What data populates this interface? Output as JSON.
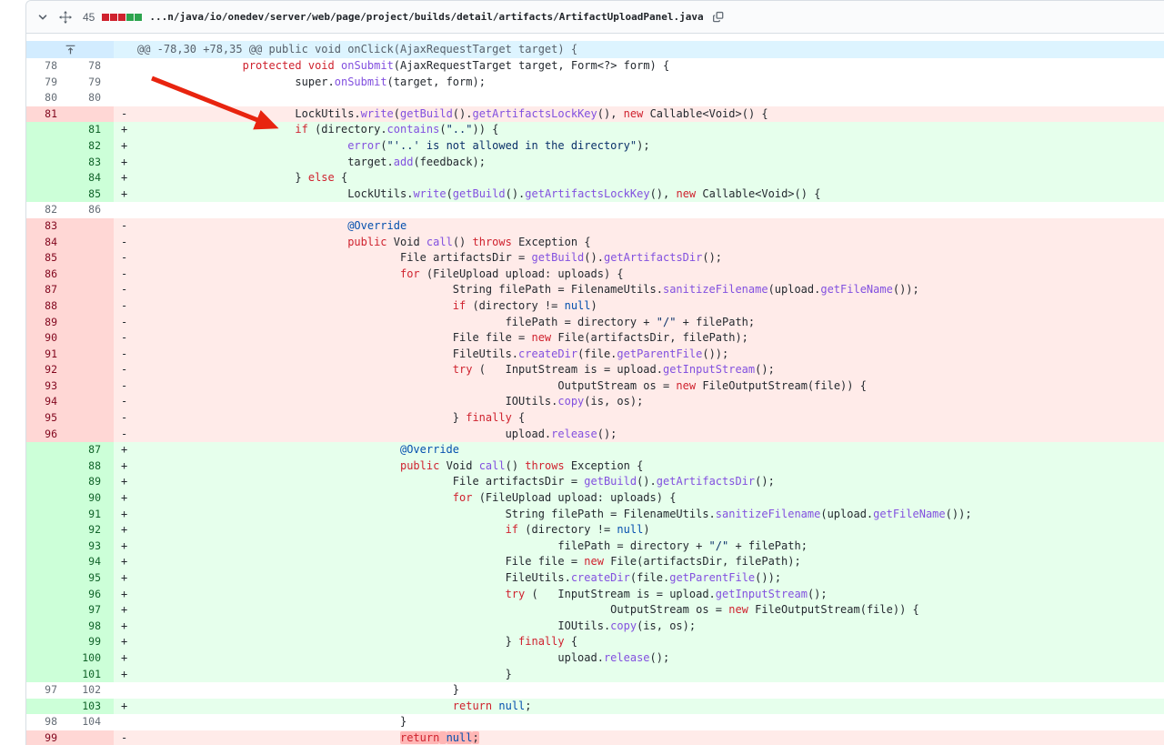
{
  "file_header": {
    "changed_lines": "45",
    "diffstat_colors": [
      "#cf222e",
      "#cf222e",
      "#cf222e",
      "#2da44e",
      "#2da44e"
    ],
    "path": "...n/java/io/onedev/server/web/page/project/builds/detail/artifacts/ArtifactUploadPanel.java",
    "icons": {
      "collapse": "chevron-down-icon",
      "drag": "move-handle-icon",
      "copy": "copy-path-icon",
      "expand": "expand-up-icon"
    }
  },
  "hunk": {
    "header_text": "@@ -78,30 +78,35 @@ public void onClick(AjaxRequestTarget target) {"
  },
  "colors": {
    "addition_line_bg": "#e6ffec",
    "addition_gutter_bg": "#ccffd8",
    "deletion_line_bg": "#ffebe9",
    "deletion_gutter_bg": "#ffd7d5",
    "deletion_word_highlight": "rgba(255,129,130,0.5)",
    "hunk_header_bg": "#ddf4ff",
    "keyword": "#cf222e",
    "method": "#8250df",
    "constant": "#0550ae",
    "string": "#0a3069",
    "annotation_arrow": "#e8240f"
  },
  "diff": {
    "rows": [
      {
        "old": "78",
        "new": "78",
        "type": "ctx",
        "marker": "",
        "indent": 16,
        "segs": [
          [
            "protected",
            "sk"
          ],
          [
            " ",
            "sp"
          ],
          [
            "void",
            "sk"
          ],
          [
            " ",
            "sp"
          ],
          [
            "onSubmit",
            "sf"
          ],
          [
            "(AjaxRequestTarget target, Form<?> form) {",
            "sp"
          ]
        ]
      },
      {
        "old": "79",
        "new": "79",
        "type": "ctx",
        "marker": "",
        "indent": 24,
        "segs": [
          [
            "super.",
            "sp"
          ],
          [
            "onSubmit",
            "sf"
          ],
          [
            "(target, form);",
            "sp"
          ]
        ]
      },
      {
        "old": "80",
        "new": "80",
        "type": "ctx",
        "marker": "",
        "indent": 0,
        "segs": []
      },
      {
        "old": "81",
        "new": "",
        "type": "del",
        "marker": "-",
        "indent": 24,
        "segs": [
          [
            "LockUtils.",
            "sp"
          ],
          [
            "write",
            "sf"
          ],
          [
            "(",
            "sp"
          ],
          [
            "getBuild",
            "sf"
          ],
          [
            "().",
            "sp"
          ],
          [
            "getArtifactsLockKey",
            "sf"
          ],
          [
            "(), ",
            "sp"
          ],
          [
            "new",
            "sk"
          ],
          [
            " Callable<Void>() {",
            "sp"
          ]
        ]
      },
      {
        "old": "",
        "new": "81",
        "type": "add",
        "marker": "+",
        "indent": 24,
        "segs": [
          [
            "if",
            "sk"
          ],
          [
            " (directory.",
            "sp"
          ],
          [
            "contains",
            "sf"
          ],
          [
            "(",
            "sp"
          ],
          [
            "\"..\"",
            "ss"
          ],
          [
            ")) {",
            "sp"
          ]
        ]
      },
      {
        "old": "",
        "new": "82",
        "type": "add",
        "marker": "+",
        "indent": 32,
        "segs": [
          [
            "error",
            "sf"
          ],
          [
            "(",
            "sp"
          ],
          [
            "\"'..' is not allowed in the directory\"",
            "ss"
          ],
          [
            ");",
            "sp"
          ]
        ]
      },
      {
        "old": "",
        "new": "83",
        "type": "add",
        "marker": "+",
        "indent": 32,
        "segs": [
          [
            "target.",
            "sp"
          ],
          [
            "add",
            "sf"
          ],
          [
            "(feedback);",
            "sp"
          ]
        ]
      },
      {
        "old": "",
        "new": "84",
        "type": "add",
        "marker": "+",
        "indent": 24,
        "segs": [
          [
            "} ",
            "sp"
          ],
          [
            "else",
            "sk"
          ],
          [
            " {",
            "sp"
          ]
        ]
      },
      {
        "old": "",
        "new": "85",
        "type": "add",
        "marker": "+",
        "indent": 32,
        "segs": [
          [
            "LockUtils.",
            "sp"
          ],
          [
            "write",
            "sf"
          ],
          [
            "(",
            "sp"
          ],
          [
            "getBuild",
            "sf"
          ],
          [
            "().",
            "sp"
          ],
          [
            "getArtifactsLockKey",
            "sf"
          ],
          [
            "(), ",
            "sp"
          ],
          [
            "new",
            "sk"
          ],
          [
            " Callable<Void>() {",
            "sp"
          ]
        ]
      },
      {
        "old": "82",
        "new": "86",
        "type": "ctx",
        "marker": "",
        "indent": 0,
        "segs": []
      },
      {
        "old": "83",
        "new": "",
        "type": "del",
        "marker": "-",
        "indent": 32,
        "segs": [
          [
            "@Override",
            "sc"
          ]
        ]
      },
      {
        "old": "84",
        "new": "",
        "type": "del",
        "marker": "-",
        "indent": 32,
        "segs": [
          [
            "public",
            "sk"
          ],
          [
            " Void ",
            "sp"
          ],
          [
            "call",
            "sf"
          ],
          [
            "() ",
            "sp"
          ],
          [
            "throws",
            "sk"
          ],
          [
            " Exception {",
            "sp"
          ]
        ]
      },
      {
        "old": "85",
        "new": "",
        "type": "del",
        "marker": "-",
        "indent": 40,
        "segs": [
          [
            "File artifactsDir = ",
            "sp"
          ],
          [
            "getBuild",
            "sf"
          ],
          [
            "().",
            "sp"
          ],
          [
            "getArtifactsDir",
            "sf"
          ],
          [
            "();",
            "sp"
          ]
        ]
      },
      {
        "old": "86",
        "new": "",
        "type": "del",
        "marker": "-",
        "indent": 40,
        "segs": [
          [
            "for",
            "sk"
          ],
          [
            " (FileUpload upload: uploads) {",
            "sp"
          ]
        ]
      },
      {
        "old": "87",
        "new": "",
        "type": "del",
        "marker": "-",
        "indent": 48,
        "segs": [
          [
            "String filePath = FilenameUtils.",
            "sp"
          ],
          [
            "sanitizeFilename",
            "sf"
          ],
          [
            "(upload.",
            "sp"
          ],
          [
            "getFileName",
            "sf"
          ],
          [
            "());",
            "sp"
          ]
        ]
      },
      {
        "old": "88",
        "new": "",
        "type": "del",
        "marker": "-",
        "indent": 48,
        "segs": [
          [
            "if",
            "sk"
          ],
          [
            " (directory != ",
            "sp"
          ],
          [
            "null",
            "sc"
          ],
          [
            ")",
            "sp"
          ]
        ]
      },
      {
        "old": "89",
        "new": "",
        "type": "del",
        "marker": "-",
        "indent": 56,
        "segs": [
          [
            "filePath = directory + ",
            "sp"
          ],
          [
            "\"/\"",
            "ss"
          ],
          [
            " + filePath;",
            "sp"
          ]
        ]
      },
      {
        "old": "90",
        "new": "",
        "type": "del",
        "marker": "-",
        "indent": 48,
        "segs": [
          [
            "File file = ",
            "sp"
          ],
          [
            "new",
            "sk"
          ],
          [
            " File(artifactsDir, filePath);",
            "sp"
          ]
        ]
      },
      {
        "old": "91",
        "new": "",
        "type": "del",
        "marker": "-",
        "indent": 48,
        "segs": [
          [
            "FileUtils.",
            "sp"
          ],
          [
            "createDir",
            "sf"
          ],
          [
            "(file.",
            "sp"
          ],
          [
            "getParentFile",
            "sf"
          ],
          [
            "());",
            "sp"
          ]
        ]
      },
      {
        "old": "92",
        "new": "",
        "type": "del",
        "marker": "-",
        "indent": 48,
        "segs": [
          [
            "try",
            "sk"
          ],
          [
            " (   InputStream is = upload.",
            "sp"
          ],
          [
            "getInputStream",
            "sf"
          ],
          [
            "();",
            "sp"
          ]
        ]
      },
      {
        "old": "93",
        "new": "",
        "type": "del",
        "marker": "-",
        "indent": 64,
        "segs": [
          [
            "OutputStream os = ",
            "sp"
          ],
          [
            "new",
            "sk"
          ],
          [
            " FileOutputStream(file)) {",
            "sp"
          ]
        ]
      },
      {
        "old": "94",
        "new": "",
        "type": "del",
        "marker": "-",
        "indent": 56,
        "segs": [
          [
            "IOUtils.",
            "sp"
          ],
          [
            "copy",
            "sf"
          ],
          [
            "(is, os);",
            "sp"
          ]
        ]
      },
      {
        "old": "95",
        "new": "",
        "type": "del",
        "marker": "-",
        "indent": 48,
        "segs": [
          [
            "} ",
            "sp"
          ],
          [
            "finally",
            "sk"
          ],
          [
            " {",
            "sp"
          ]
        ]
      },
      {
        "old": "96",
        "new": "",
        "type": "del",
        "marker": "-",
        "indent": 56,
        "segs": [
          [
            "upload.",
            "sp"
          ],
          [
            "release",
            "sf"
          ],
          [
            "();",
            "sp"
          ]
        ]
      },
      {
        "old": "",
        "new": "87",
        "type": "add",
        "marker": "+",
        "indent": 40,
        "segs": [
          [
            "@Override",
            "sc"
          ]
        ]
      },
      {
        "old": "",
        "new": "88",
        "type": "add",
        "marker": "+",
        "indent": 40,
        "segs": [
          [
            "public",
            "sk"
          ],
          [
            " Void ",
            "sp"
          ],
          [
            "call",
            "sf"
          ],
          [
            "() ",
            "sp"
          ],
          [
            "throws",
            "sk"
          ],
          [
            " Exception {",
            "sp"
          ]
        ]
      },
      {
        "old": "",
        "new": "89",
        "type": "add",
        "marker": "+",
        "indent": 48,
        "segs": [
          [
            "File artifactsDir = ",
            "sp"
          ],
          [
            "getBuild",
            "sf"
          ],
          [
            "().",
            "sp"
          ],
          [
            "getArtifactsDir",
            "sf"
          ],
          [
            "();",
            "sp"
          ]
        ]
      },
      {
        "old": "",
        "new": "90",
        "type": "add",
        "marker": "+",
        "indent": 48,
        "segs": [
          [
            "for",
            "sk"
          ],
          [
            " (FileUpload upload: uploads) {",
            "sp"
          ]
        ]
      },
      {
        "old": "",
        "new": "91",
        "type": "add",
        "marker": "+",
        "indent": 56,
        "segs": [
          [
            "String filePath = FilenameUtils.",
            "sp"
          ],
          [
            "sanitizeFilename",
            "sf"
          ],
          [
            "(upload.",
            "sp"
          ],
          [
            "getFileName",
            "sf"
          ],
          [
            "());",
            "sp"
          ]
        ]
      },
      {
        "old": "",
        "new": "92",
        "type": "add",
        "marker": "+",
        "indent": 56,
        "segs": [
          [
            "if",
            "sk"
          ],
          [
            " (directory != ",
            "sp"
          ],
          [
            "null",
            "sc"
          ],
          [
            ")",
            "sp"
          ]
        ]
      },
      {
        "old": "",
        "new": "93",
        "type": "add",
        "marker": "+",
        "indent": 64,
        "segs": [
          [
            "filePath = directory + ",
            "sp"
          ],
          [
            "\"/\"",
            "ss"
          ],
          [
            " + filePath;",
            "sp"
          ]
        ]
      },
      {
        "old": "",
        "new": "94",
        "type": "add",
        "marker": "+",
        "indent": 56,
        "segs": [
          [
            "File file = ",
            "sp"
          ],
          [
            "new",
            "sk"
          ],
          [
            " File(artifactsDir, filePath);",
            "sp"
          ]
        ]
      },
      {
        "old": "",
        "new": "95",
        "type": "add",
        "marker": "+",
        "indent": 56,
        "segs": [
          [
            "FileUtils.",
            "sp"
          ],
          [
            "createDir",
            "sf"
          ],
          [
            "(file.",
            "sp"
          ],
          [
            "getParentFile",
            "sf"
          ],
          [
            "());",
            "sp"
          ]
        ]
      },
      {
        "old": "",
        "new": "96",
        "type": "add",
        "marker": "+",
        "indent": 56,
        "segs": [
          [
            "try",
            "sk"
          ],
          [
            " (   InputStream is = upload.",
            "sp"
          ],
          [
            "getInputStream",
            "sf"
          ],
          [
            "();",
            "sp"
          ]
        ]
      },
      {
        "old": "",
        "new": "97",
        "type": "add",
        "marker": "+",
        "indent": 72,
        "segs": [
          [
            "OutputStream os = ",
            "sp"
          ],
          [
            "new",
            "sk"
          ],
          [
            " FileOutputStream(file)) {",
            "sp"
          ]
        ]
      },
      {
        "old": "",
        "new": "98",
        "type": "add",
        "marker": "+",
        "indent": 64,
        "segs": [
          [
            "IOUtils.",
            "sp"
          ],
          [
            "copy",
            "sf"
          ],
          [
            "(is, os);",
            "sp"
          ]
        ]
      },
      {
        "old": "",
        "new": "99",
        "type": "add",
        "marker": "+",
        "indent": 56,
        "segs": [
          [
            "} ",
            "sp"
          ],
          [
            "finally",
            "sk"
          ],
          [
            " {",
            "sp"
          ]
        ]
      },
      {
        "old": "",
        "new": "100",
        "type": "add",
        "marker": "+",
        "indent": 64,
        "segs": [
          [
            "upload.",
            "sp"
          ],
          [
            "release",
            "sf"
          ],
          [
            "();",
            "sp"
          ]
        ]
      },
      {
        "old": "",
        "new": "101",
        "type": "add",
        "marker": "+",
        "indent": 56,
        "segs": [
          [
            "}",
            "sp"
          ]
        ]
      },
      {
        "old": "97",
        "new": "102",
        "type": "ctx",
        "marker": "",
        "indent": 48,
        "segs": [
          [
            "}",
            "sp"
          ]
        ]
      },
      {
        "old": "",
        "new": "103",
        "type": "add",
        "marker": "+",
        "indent": 48,
        "segs": [
          [
            "return",
            "sk"
          ],
          [
            " ",
            "sp"
          ],
          [
            "null",
            "sc"
          ],
          [
            ";",
            "sp"
          ]
        ]
      },
      {
        "old": "98",
        "new": "104",
        "type": "ctx",
        "marker": "",
        "indent": 40,
        "segs": [
          [
            "}",
            "sp"
          ]
        ]
      },
      {
        "old": "99",
        "new": "",
        "type": "del",
        "marker": "-",
        "indent": 40,
        "segs": [
          [
            "return",
            "sk hl"
          ],
          [
            " ",
            "sp hl"
          ],
          [
            "null",
            "sc hl"
          ],
          [
            ";",
            "sp hl"
          ]
        ]
      }
    ]
  }
}
